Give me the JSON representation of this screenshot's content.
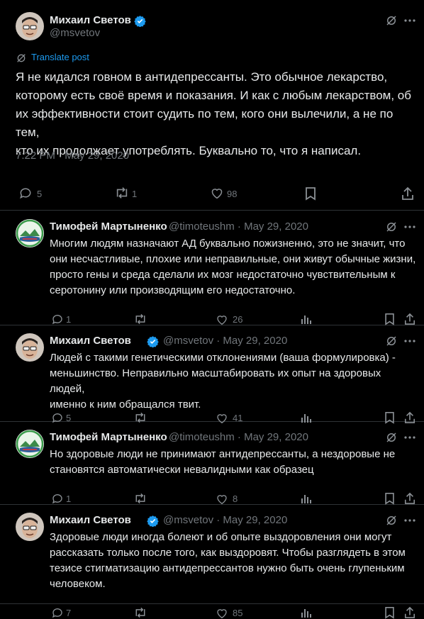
{
  "main_post": {
    "author_name": "Михаил Светов",
    "author_handle": "@msvetov",
    "translate_label": "Translate post",
    "text": "Я не кидался говном в антидепрессанты. Это обычное лекарство,\nкоторому есть своё время и показания. И как с любым лекарством, об\nих эффективности стоит судить по тем, кого они вылечили, а не по тем,\nкто их продолжает употреблять. Буквально то, что я написал.",
    "timestamp": "7:22 PM · May 29, 2020",
    "replies": "5",
    "reposts": "1",
    "likes": "98"
  },
  "replies": [
    {
      "author_name": "Тимофей Мартыненко",
      "meta": "@timoteushm · May 29, 2020",
      "text": "Многим людям назначают АД буквально пожизненно, это не значит, что\nони несчастливые, плохие или неправильные, они живут обычные жизни,\nпросто гены и среда сделали их мозг недостаточно чувствительным к\nсеротонину или производящим его недостаточно.",
      "replies": "1",
      "reposts": "",
      "likes": "26"
    },
    {
      "author_name": "Михаил Светов",
      "meta": "@msvetov · May 29, 2020",
      "text": "Людей с такими генетическими отклонениями (ваша формулировка) -\nменьшинство. Неправильно масштабировать их опыт на здоровых людей,\nименно к ним обращался твит.",
      "replies": "5",
      "reposts": "",
      "likes": "41"
    },
    {
      "author_name": "Тимофей Мартыненко",
      "meta": "@timoteushm · May 29, 2020",
      "text": "Но здоровые люди не принимают антидепрессанты, а нездоровые не\nстановятся автоматически невалидными как образец",
      "replies": "1",
      "reposts": "",
      "likes": "8"
    },
    {
      "author_name": "Михаил Светов",
      "meta": "@msvetov · May 29, 2020",
      "text": "Здоровые люди иногда болеют и об опыте выздоровления они могут\nрассказать только после того, как выздоровят. Чтобы разглядеть в этом\nтезисе стигматизацию антидепрессантов нужно быть очень глупеньким\nчеловеком.",
      "replies": "7",
      "reposts": "",
      "likes": "85"
    }
  ],
  "colors": {
    "background": "#000000",
    "text": "#e7e9ea",
    "muted": "#71767b",
    "accent": "#1d9bf0",
    "divider": "#2f3336"
  },
  "icons": [
    "verified-icon",
    "grok-icon",
    "more-icon",
    "translate-icon",
    "reply-icon",
    "repost-icon",
    "like-icon",
    "views-icon",
    "bookmark-icon",
    "share-icon"
  ]
}
